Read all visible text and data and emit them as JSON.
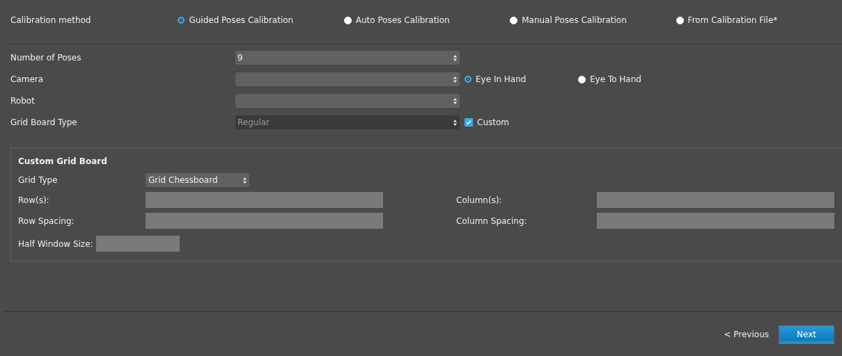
{
  "calibration_method": {
    "label": "Calibration method",
    "options": [
      {
        "label": "Guided Poses Calibration",
        "selected": true
      },
      {
        "label": "Auto Poses Calibration",
        "selected": false
      },
      {
        "label": "Manual Poses Calibration",
        "selected": false
      },
      {
        "label": "From Calibration File*",
        "selected": false
      }
    ]
  },
  "settings": [
    {
      "label": "Number of Poses",
      "value": "9",
      "disabled": false
    },
    {
      "label": "Camera",
      "disabled": false,
      "extras": [
        {
          "kind": "radio",
          "label": "Eye In Hand",
          "selected": true
        },
        {
          "kind": "radio",
          "label": "Eye To Hand",
          "selected": false
        }
      ]
    },
    {
      "label": "Robot",
      "disabled": false
    },
    {
      "label": "Grid Board Type",
      "value": "Regular",
      "disabled": true,
      "extras": [
        {
          "kind": "checkbox",
          "label": "Custom",
          "checked": true
        }
      ]
    }
  ],
  "custom_grid_board": {
    "title": "Custom Grid Board",
    "grid_type": {
      "label": "Grid Type",
      "value": "Grid Chessboard"
    },
    "fields": [
      {
        "label": "Row(s):"
      },
      {
        "label": "Column(s):"
      },
      {
        "label": "Row Spacing:"
      },
      {
        "label": "Column Spacing:"
      }
    ],
    "half_window_size": {
      "label": "Half Window Size:"
    }
  },
  "footer": {
    "previous": "< Previous",
    "next": "Next"
  }
}
